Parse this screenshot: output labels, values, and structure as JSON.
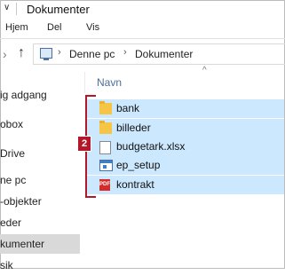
{
  "window": {
    "title": "Dokumenter",
    "chevron": "∨"
  },
  "ribbon": {
    "tabs": [
      "Hjem",
      "Del",
      "Vis"
    ]
  },
  "nav": {
    "forward_symbol": "›",
    "up_symbol": "↑"
  },
  "breadcrumb": {
    "items": [
      "Denne pc",
      "Dokumenter"
    ],
    "separator": "›"
  },
  "sort": {
    "caret": "^"
  },
  "columns": {
    "name": "Navn"
  },
  "navpane": {
    "items": [
      "ig adgang",
      "obox",
      "Drive",
      "ne pc",
      "-objekter",
      "eder",
      "kumenter",
      "sik"
    ]
  },
  "files": [
    {
      "name": "bank",
      "icon": "folder-icon"
    },
    {
      "name": "billeder",
      "icon": "folder-icon"
    },
    {
      "name": "budgetark.xlsx",
      "icon": "document-icon"
    },
    {
      "name": "ep_setup",
      "icon": "setup-app-icon"
    },
    {
      "name": "kontrakt",
      "icon": "pdf-icon"
    }
  ],
  "callout": {
    "number": "2",
    "color": "#b3172a"
  },
  "colors": {
    "selection": "#cce8ff",
    "accent": "#b3172a"
  }
}
